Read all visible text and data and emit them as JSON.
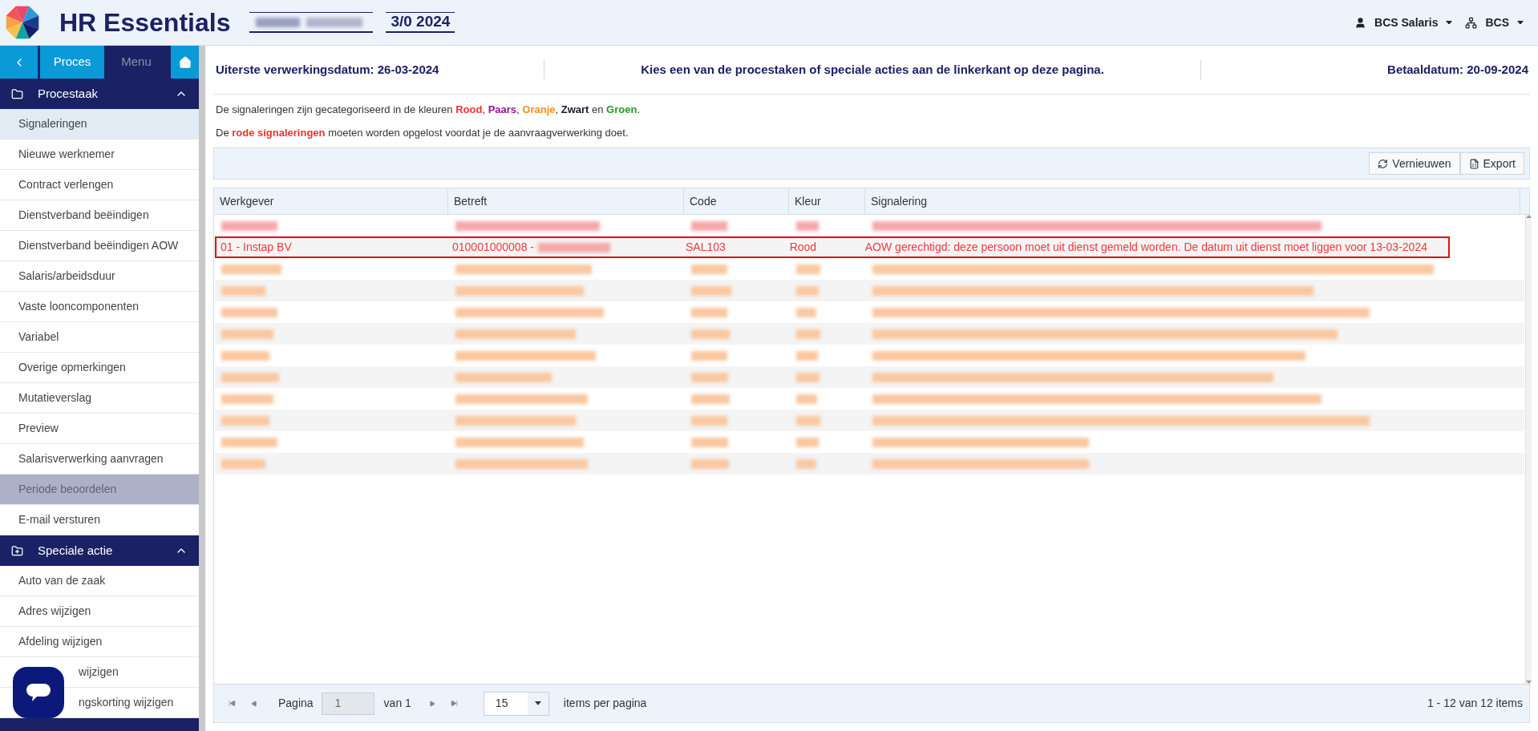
{
  "header": {
    "app_title": "HR Essentials",
    "period": "3/0 2024",
    "user": "BCS Salaris",
    "company": "BCS"
  },
  "nav": {
    "tabs": [
      {
        "label": "Proces",
        "selected": true
      },
      {
        "label": "Menu",
        "selected": false
      }
    ]
  },
  "sidebar": {
    "sections": [
      {
        "title": "Procestaak",
        "expanded": true,
        "items": [
          {
            "label": "Signaleringen",
            "selected": true,
            "disabled": false
          },
          {
            "label": "Nieuwe werknemer",
            "selected": false,
            "disabled": false
          },
          {
            "label": "Contract verlengen",
            "selected": false,
            "disabled": false
          },
          {
            "label": "Dienstverband beëindigen",
            "selected": false,
            "disabled": false
          },
          {
            "label": "Dienstverband beëindigen AOW",
            "selected": false,
            "disabled": false
          },
          {
            "label": "Salaris/arbeidsduur",
            "selected": false,
            "disabled": false
          },
          {
            "label": "Vaste looncomponenten",
            "selected": false,
            "disabled": false
          },
          {
            "label": "Variabel",
            "selected": false,
            "disabled": false
          },
          {
            "label": "Overige opmerkingen",
            "selected": false,
            "disabled": false
          },
          {
            "label": "Mutatieverslag",
            "selected": false,
            "disabled": false
          },
          {
            "label": "Preview",
            "selected": false,
            "disabled": false
          },
          {
            "label": "Salarisverwerking aanvragen",
            "selected": false,
            "disabled": false
          },
          {
            "label": "Periode beoordelen",
            "selected": false,
            "disabled": true
          },
          {
            "label": "E-mail versturen",
            "selected": false,
            "disabled": false
          }
        ]
      },
      {
        "title": "Speciale actie",
        "expanded": true,
        "items": [
          {
            "label": "Auto van de zaak",
            "selected": false,
            "disabled": false
          },
          {
            "label": "Adres wijzigen",
            "selected": false,
            "disabled": false
          },
          {
            "label": "Afdeling wijzigen",
            "selected": false,
            "disabled": false
          },
          {
            "label": "wijzigen",
            "selected": false,
            "disabled": false
          },
          {
            "label": "ngskorting wijzigen",
            "selected": false,
            "disabled": false
          }
        ]
      }
    ]
  },
  "info_bar": {
    "deadline": "Uiterste verwerkingsdatum: 26-03-2024",
    "instruction": "Kies een van de procestaken of speciale acties aan de linkerkant op deze pagina.",
    "pay_date": "Betaaldatum: 20-09-2024"
  },
  "legend": [
    {
      "parts": [
        {
          "text": "De signaleringen zijn gecategoriseerd in de kleuren "
        },
        {
          "text": "Rood",
          "color": "#f4302e"
        },
        {
          "text": ", "
        },
        {
          "text": "Paars",
          "color": "#8e1a8e"
        },
        {
          "text": ", "
        },
        {
          "text": "Oranje",
          "color": "#ff8c1a"
        },
        {
          "text": ", "
        },
        {
          "text": "Zwart",
          "color": "#1a1a2e"
        },
        {
          "text": " en "
        },
        {
          "text": "Groen",
          "color": "#1e9e1e"
        },
        {
          "text": "."
        }
      ]
    },
    {
      "parts": [
        {
          "text": "De "
        },
        {
          "text": "rode signaleringen",
          "color": "#f4302e"
        },
        {
          "text": " moeten worden opgelost voordat je de aanvraagverwerking doet."
        }
      ]
    }
  ],
  "toolbar": {
    "buttons": [
      {
        "kind": "refresh",
        "label": "Vernieuwen"
      },
      {
        "kind": "export",
        "label": "Export"
      }
    ]
  },
  "table": {
    "columns": [
      "Werkgever",
      "Betreft",
      "Code",
      "Kleur",
      "Signalering"
    ],
    "rows": [
      {
        "kind": "redacted",
        "color": "#f6a8a8",
        "highlighted": false
      },
      {
        "kind": "text",
        "highlighted": true,
        "cells": [
          {
            "text": "01 - Instap BV"
          },
          {
            "text": "010001000008 -",
            "redacted_suffix": true
          },
          {
            "text": "SAL103"
          },
          {
            "text": "Rood"
          },
          {
            "text": "AOW gerechtigd: deze persoon moet uit dienst gemeld worden. De datum uit dienst moet liggen voor 13-03-2024"
          }
        ]
      },
      {
        "kind": "redacted",
        "color": "#f9c7a0",
        "highlighted": false
      },
      {
        "kind": "redacted",
        "color": "#f9c7a0",
        "highlighted": false
      },
      {
        "kind": "redacted",
        "color": "#f9c7a0",
        "highlighted": false
      },
      {
        "kind": "redacted",
        "color": "#f9c7a0",
        "highlighted": false
      },
      {
        "kind": "redacted",
        "color": "#f9c7a0",
        "highlighted": false
      },
      {
        "kind": "redacted",
        "color": "#f9c7a0",
        "highlighted": false
      },
      {
        "kind": "redacted",
        "color": "#f9c7a0",
        "highlighted": false
      },
      {
        "kind": "redacted",
        "color": "#f9c7a0",
        "highlighted": false
      },
      {
        "kind": "redacted",
        "color": "#f9c7a0",
        "highlighted": false
      },
      {
        "kind": "redacted",
        "color": "#f9c7a0",
        "highlighted": false
      }
    ]
  },
  "pager": {
    "page_label": "Pagina",
    "page": "1",
    "of": "van 1",
    "page_size": "15",
    "per_page": "items per pagina",
    "summary": "1 - 12 van 12 items"
  }
}
